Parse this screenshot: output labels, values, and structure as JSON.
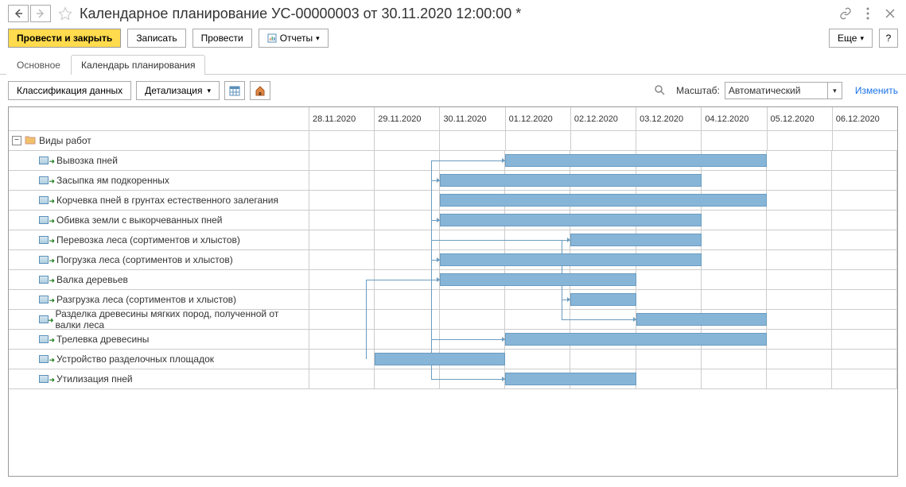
{
  "title": "Календарное планирование УС-00000003 от 30.11.2020 12:00:00 *",
  "toolbar": {
    "post_and_close": "Провести и закрыть",
    "save": "Записать",
    "post": "Провести",
    "reports": "Отчеты",
    "more": "Еще",
    "help": "?"
  },
  "tabs": {
    "main": "Основное",
    "calendar": "Календарь планирования"
  },
  "subtoolbar": {
    "classification": "Классификация данных",
    "detail": "Детализация",
    "scale_label": "Масштаб:",
    "scale_value": "Автоматический",
    "change": "Изменить"
  },
  "timeline": {
    "columns": [
      "28.11.2020",
      "29.11.2020",
      "30.11.2020",
      "01.12.2020",
      "02.12.2020",
      "03.12.2020",
      "04.12.2020",
      "05.12.2020",
      "06.12.2020"
    ]
  },
  "tree": {
    "root": "Виды работ",
    "items": [
      {
        "label": "Вывозка пней"
      },
      {
        "label": "Засыпка ям подкоренных"
      },
      {
        "label": "Корчевка пней в грунтах естественного залегания"
      },
      {
        "label": "Обивка земли с выкорчеванных пней"
      },
      {
        "label": "Перевозка леса (сортиментов и хлыстов)"
      },
      {
        "label": "Погрузка леса (сортиментов и хлыстов)"
      },
      {
        "label": "Валка деревьев"
      },
      {
        "label": "Разгрузка леса (сортиментов и хлыстов)"
      },
      {
        "label": "Разделка древесины мягких пород, полученной от валки леса"
      },
      {
        "label": "Трелевка древесины"
      },
      {
        "label": "Устройство разделочных площадок"
      },
      {
        "label": "Утилизация пней"
      }
    ]
  },
  "chart_data": {
    "type": "gantt",
    "x_start": "28.11.2020",
    "x_end": "06.12.2020",
    "tasks": [
      {
        "name": "Вывозка пней",
        "start": 3.0,
        "end": 7.0
      },
      {
        "name": "Засыпка ям подкоренных",
        "start": 2.0,
        "end": 6.0
      },
      {
        "name": "Корчевка пней в грунтах естественного залегания",
        "start": 2.0,
        "end": 7.0
      },
      {
        "name": "Обивка земли с выкорчеванных пней",
        "start": 2.0,
        "end": 6.0
      },
      {
        "name": "Перевозка леса (сортиментов и хлыстов)",
        "start": 4.0,
        "end": 6.0
      },
      {
        "name": "Погрузка леса (сортиментов и хлыстов)",
        "start": 2.0,
        "end": 6.0
      },
      {
        "name": "Валка деревьев",
        "start": 2.0,
        "end": 5.0
      },
      {
        "name": "Разгрузка леса (сортиментов и хлыстов)",
        "start": 4.0,
        "end": 5.0
      },
      {
        "name": "Разделка древесины мягких пород, полученной от валки леса",
        "start": 5.0,
        "end": 7.0
      },
      {
        "name": "Трелевка древесины",
        "start": 3.0,
        "end": 7.0
      },
      {
        "name": "Устройство разделочных площадок",
        "start": 1.0,
        "end": 3.0
      },
      {
        "name": "Утилизация пней",
        "start": 3.0,
        "end": 5.0
      }
    ]
  }
}
